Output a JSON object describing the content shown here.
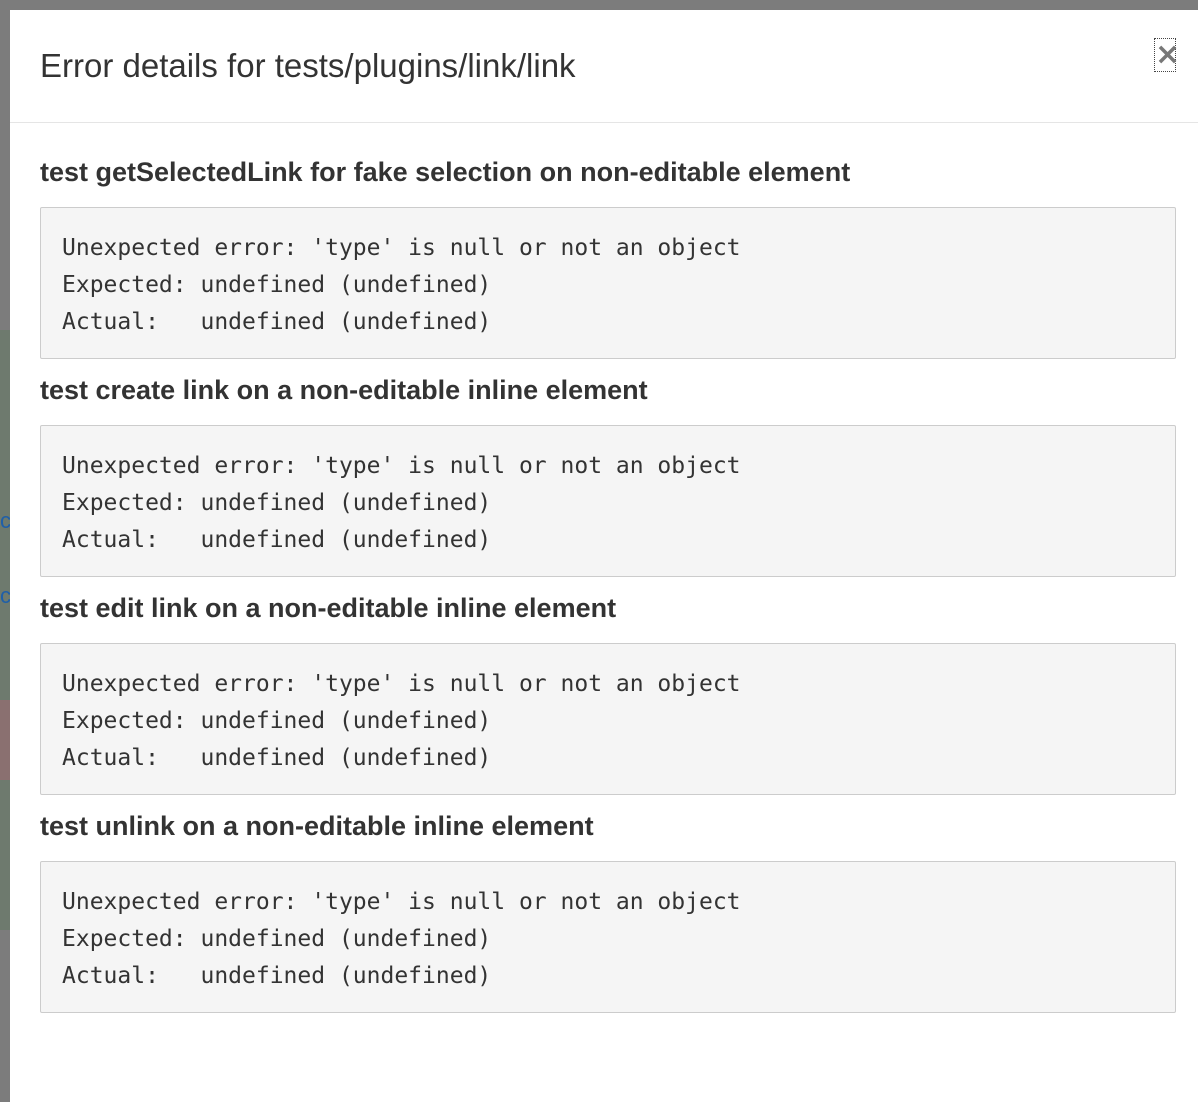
{
  "modal": {
    "title": "Error details for tests/plugins/link/link",
    "close_label": "×"
  },
  "tests": [
    {
      "name": "test getSelectedLink for fake selection on non-editable element",
      "lines": [
        "Unexpected error: 'type' is null or not an object",
        "Expected: undefined (undefined)",
        "Actual:   undefined (undefined)"
      ]
    },
    {
      "name": "test create link on a non-editable inline element",
      "lines": [
        "Unexpected error: 'type' is null or not an object",
        "Expected: undefined (undefined)",
        "Actual:   undefined (undefined)"
      ]
    },
    {
      "name": "test edit link on a non-editable inline element",
      "lines": [
        "Unexpected error: 'type' is null or not an object",
        "Expected: undefined (undefined)",
        "Actual:   undefined (undefined)"
      ]
    },
    {
      "name": "test unlink on a non-editable inline element",
      "lines": [
        "Unexpected error: 'type' is null or not an object",
        "Expected: undefined (undefined)",
        "Actual:   undefined (undefined)"
      ]
    }
  ],
  "backdrop": {
    "glyph": "c"
  }
}
